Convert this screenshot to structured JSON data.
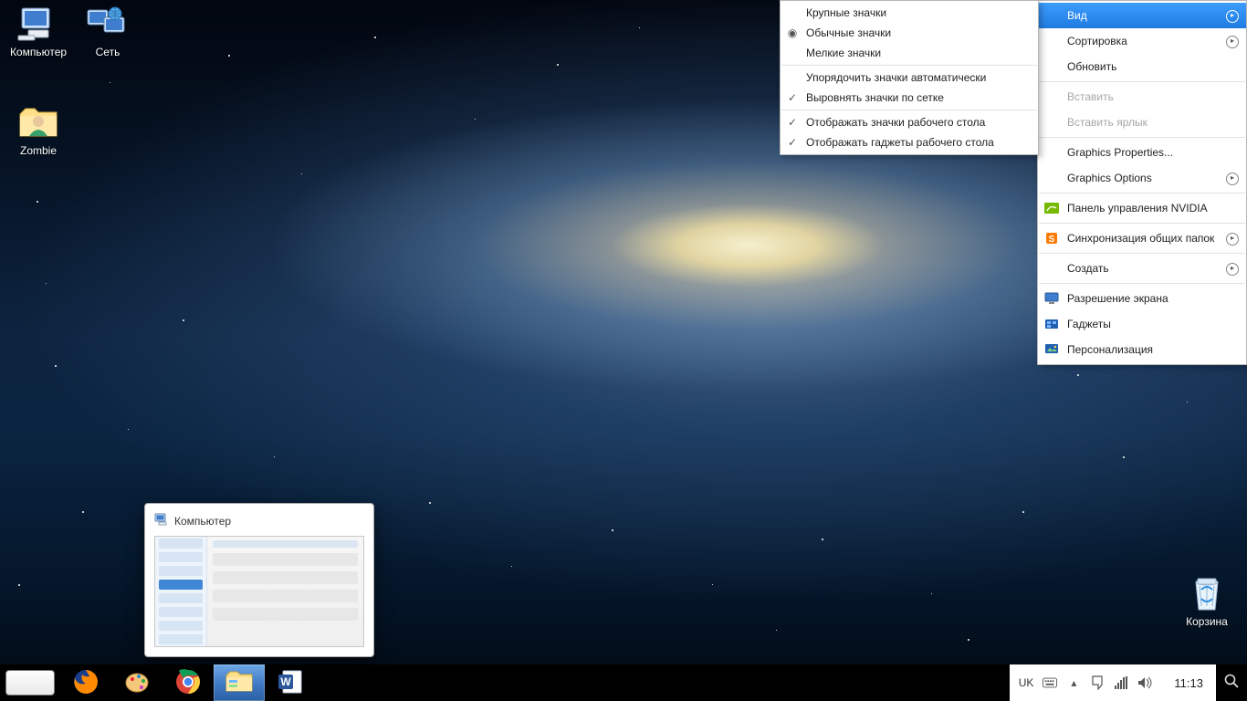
{
  "desktop_icons": {
    "computer": "Компьютер",
    "network": "Сеть",
    "zombie": "Zombie",
    "recycle": "Корзина"
  },
  "preview": {
    "title": "Компьютер"
  },
  "tray": {
    "lang": "UK",
    "clock": "11:13"
  },
  "context_menu": {
    "view": "Вид",
    "sort": "Сортировка",
    "refresh": "Обновить",
    "paste": "Вставить",
    "paste_shortcut": "Вставить ярлык",
    "graphics_props": "Graphics Properties...",
    "graphics_opts": "Graphics Options",
    "nvidia": "Панель управления NVIDIA",
    "sync_folders": "Синхронизация общих папок",
    "create": "Создать",
    "resolution": "Разрешение экрана",
    "gadgets": "Гаджеты",
    "personalize": "Персонализация"
  },
  "view_submenu": {
    "large": "Крупные значки",
    "medium": "Обычные значки",
    "small": "Мелкие значки",
    "auto": "Упорядочить значки автоматически",
    "grid": "Выровнять значки по сетке",
    "show_icons": "Отображать значки рабочего стола",
    "show_gadgets": "Отображать гаджеты  рабочего стола"
  }
}
